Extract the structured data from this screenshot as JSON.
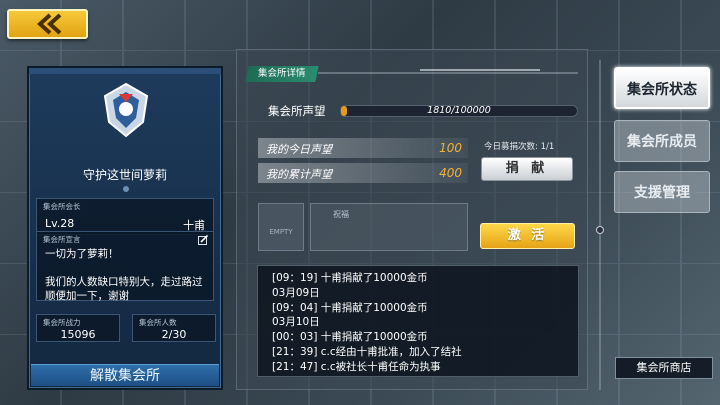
{
  "header": {
    "back_icon": "double-chevron-left-icon"
  },
  "guild": {
    "name": "守护这世间萝莉",
    "leader_label": "集会所会长",
    "leader_level": "Lv.28",
    "leader_name": "十甫",
    "declaration_label": "集会所宣言",
    "declaration_text": "一切为了萝莉！\n\n我们的人数缺口特别大，走过路过顺便加一下，谢谢",
    "power_label": "集会所战力",
    "power_value": "15096",
    "members_label": "集会所人数",
    "members_value": "2/30",
    "disband_label": "解散集会所"
  },
  "details": {
    "tab_title": "集会所详情",
    "reputation_label": "集会所声望",
    "reputation_text": "1810/100000",
    "reputation_progress": 0.0181,
    "today_label": "我的今日声望",
    "today_value": "100",
    "total_label": "我的累计声望",
    "total_value": "400",
    "donate_count": "今日募捐次数: 1/1",
    "donate_label": "捐 献",
    "empty_label": "EMPTY",
    "blessing_label": "祝福",
    "activate_label": "激 活",
    "log": [
      "[09：19] 十甫捐献了10000金币",
      "03月09日",
      "[09：04] 十甫捐献了10000金币",
      "03月10日",
      "[00：03] 十甫捐献了10000金币",
      "[21：39] c.c经由十甫批准，加入了结社",
      "[21：47] c.c被社长十甫任命为执事"
    ]
  },
  "right_tabs": {
    "status": "集会所状态",
    "members": "集会所成员",
    "support": "支援管理",
    "shop": "集会所商店"
  },
  "colors": {
    "accent_gold": "#e6a316",
    "panel_blue": "#1e3b5c",
    "tab_green": "#2a8c6e"
  }
}
